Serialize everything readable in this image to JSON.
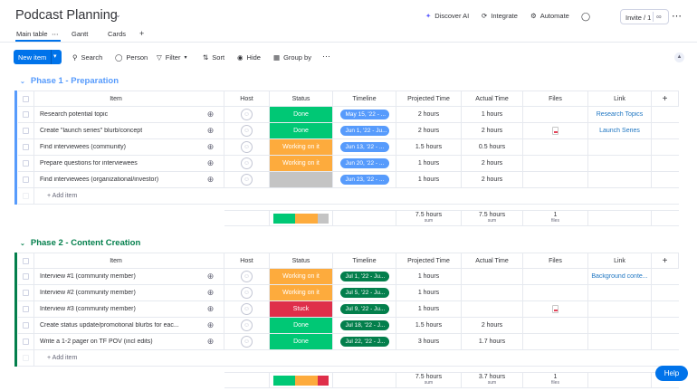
{
  "board": {
    "title": "Podcast Planning"
  },
  "top_actions": {
    "discover_ai": "Discover AI",
    "integrate": "Integrate",
    "automate": "Automate",
    "invite": "Invite / 1"
  },
  "tabs": [
    {
      "label": "Main table"
    },
    {
      "label": "Gantt"
    },
    {
      "label": "Cards"
    }
  ],
  "toolbar": {
    "new_item": "New item",
    "search": "Search",
    "person": "Person",
    "filter": "Filter",
    "sort": "Sort",
    "hide": "Hide",
    "group_by": "Group by"
  },
  "columns": {
    "item": "Item",
    "host": "Host",
    "status": "Status",
    "timeline": "Timeline",
    "projected": "Projected Time",
    "actual": "Actual Time",
    "files": "Files",
    "link": "Link",
    "add": "+"
  },
  "colors": {
    "done": "#00c875",
    "working": "#fdab3d",
    "stuck": "#df2f4a",
    "empty": "#c4c4c4",
    "timeline_blue": "#579bfc",
    "timeline_green": "#037f4c",
    "phase1": "#579bfc",
    "phase2": "#037f4c"
  },
  "groups": [
    {
      "title": "Phase 1 - Preparation",
      "color": "#579bfc",
      "rows": [
        {
          "item": "Research potential topic",
          "status": "Done",
          "status_color": "#00c875",
          "timeline": "May 15, '22 - ...",
          "projected": "2 hours",
          "actual": "1 hours",
          "file": false,
          "link": "Research Topics"
        },
        {
          "item": "Create \"launch series\" blurb/concept",
          "status": "Done",
          "status_color": "#00c875",
          "timeline": "Jun 1, '22 - Ju...",
          "projected": "2 hours",
          "actual": "2 hours",
          "file": true,
          "link": "Launch Series"
        },
        {
          "item": "Find interviewees (community)",
          "status": "Working on it",
          "status_color": "#fdab3d",
          "timeline": "Jun 13, '22 - ...",
          "projected": "1.5 hours",
          "actual": "0.5 hours",
          "file": false,
          "link": ""
        },
        {
          "item": "Prepare questions for interviewees",
          "status": "Working on it",
          "status_color": "#fdab3d",
          "timeline": "Jun 20, '22 - ...",
          "projected": "1 hours",
          "actual": "2 hours",
          "file": false,
          "link": ""
        },
        {
          "item": "Find interviewees (organizational/investor)",
          "status": "",
          "status_color": "#c4c4c4",
          "timeline": "Jun 23, '22 - ...",
          "projected": "1 hours",
          "actual": "2 hours",
          "file": false,
          "link": ""
        }
      ],
      "add_item": "+ Add item",
      "summary": {
        "projected": "7.5 hours",
        "projected_sub": "sum",
        "actual": "7.5 hours",
        "actual_sub": "sum",
        "files": "1",
        "files_sub": "files",
        "status_bar": [
          0.4,
          0.4,
          0.2
        ]
      }
    },
    {
      "title": "Phase 2 - Content Creation",
      "color": "#037f4c",
      "rows": [
        {
          "item": "Interview #1 (community member)",
          "status": "Working on it",
          "status_color": "#fdab3d",
          "timeline": "Jul 1, '22 - Ju...",
          "projected": "1 hours",
          "actual": "",
          "file": false,
          "link": "Background conte..."
        },
        {
          "item": "Interview #2 (community member)",
          "status": "Working on it",
          "status_color": "#fdab3d",
          "timeline": "Jul 5, '22 - Ju...",
          "projected": "1 hours",
          "actual": "",
          "file": false,
          "link": ""
        },
        {
          "item": "Interview #3 (community member)",
          "status": "Stuck",
          "status_color": "#df2f4a",
          "timeline": "Jul 9, '22 - Ju...",
          "projected": "1 hours",
          "actual": "",
          "file": true,
          "link": ""
        },
        {
          "item": "Create status update/promotional blurbs for eac...",
          "status": "Done",
          "status_color": "#00c875",
          "timeline": "Jul 18, '22 - J...",
          "projected": "1.5 hours",
          "actual": "2 hours",
          "file": false,
          "link": ""
        },
        {
          "item": "Write a 1-2 pager on TF POV (incl edits)",
          "status": "Done",
          "status_color": "#00c875",
          "timeline": "Jul 22, '22 - J...",
          "projected": "3 hours",
          "actual": "1.7 hours",
          "file": false,
          "link": ""
        }
      ],
      "add_item": "+ Add item",
      "summary": {
        "projected": "7.5 hours",
        "projected_sub": "sum",
        "actual": "3.7 hours",
        "actual_sub": "sum",
        "files": "1",
        "files_sub": "files",
        "status_bar": [
          0.4,
          0.4,
          0.2
        ]
      }
    }
  ],
  "help": "Help"
}
